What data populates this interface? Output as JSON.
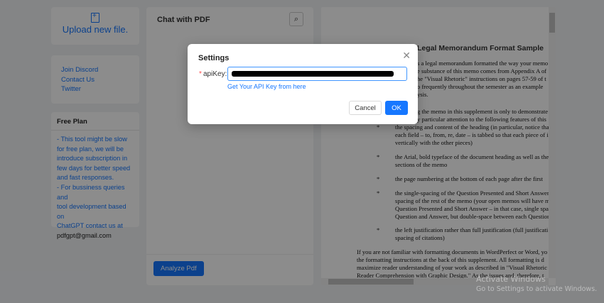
{
  "sidebar": {
    "upload_label": "Upload new file.",
    "links": [
      "Join Discord",
      "Contact Us",
      "Twitter"
    ],
    "plan": {
      "title": "Free Plan",
      "lines": [
        "- This tool might be slow",
        "for free plan, we will be",
        "introduce subscription in",
        "few days for better speed",
        "and fast responses.",
        "- For bussiness queries and",
        "tool development based on",
        "ChatGPT contact us at"
      ],
      "email": "pdfgpt@gmail.com"
    }
  },
  "chat": {
    "title": "Chat with PDF",
    "search_icon": "search-icon",
    "analyze_label": "Analyze Pdf"
  },
  "pdf": {
    "heading": "Legal Memorandum Format Sample",
    "lines": [
      "s a legal memorandum formatted the way your memo",
      "e substance of this memo comes from Appendix A of",
      "he \"Visual Rhetoric\" instructions on pages 57-59 of t",
      "o frequently throughout the semester as an example",
      "ysis.",
      "g the memo in this supplement is only to demonstrate",
      "y particular attention to the following features of this",
      "the spacing and content of the heading (in particular, notice tha",
      "each field – to, from, re, date – is tabbed so that each piece of i",
      "vertically with the other pieces)",
      "the Arial, bold typeface of the document heading as well as the",
      "sections of the memo",
      "the page numbering at the bottom of each page after the first",
      "the single-spacing of the Question Presented and Short Answer",
      "spacing of the rest of the memo (your open memos will have m",
      "Question Presented and Short Answer – in that case, single spa",
      "Question and Answer, but double-space between each Question",
      "the left justification rather than full justification (full justificati",
      "spacing of citations)",
      "If you are not familiar with formatting documents in WordPerfect or Word, yo",
      "the formatting instructions at the back of this supplement.  All formatting is d",
      "maximize reader understanding of your work as described in \"Visual Rhetoric",
      "Reader Comprehension with Graphic Design.\"  As the issues and, therefore, t"
    ]
  },
  "modal": {
    "title": "Settings",
    "required_mark": "*",
    "field_label": "apiKey:",
    "api_key_link": "Get Your API Key from here",
    "cancel_label": "Cancel",
    "ok_label": "OK",
    "close_icon": "close-icon"
  },
  "watermark": {
    "line1": "Activate Windows",
    "line2": "Go to Settings to activate Windows."
  },
  "colors": {
    "accent": "#1677ff",
    "overlay": "rgba(0,0,0,0.45)"
  }
}
